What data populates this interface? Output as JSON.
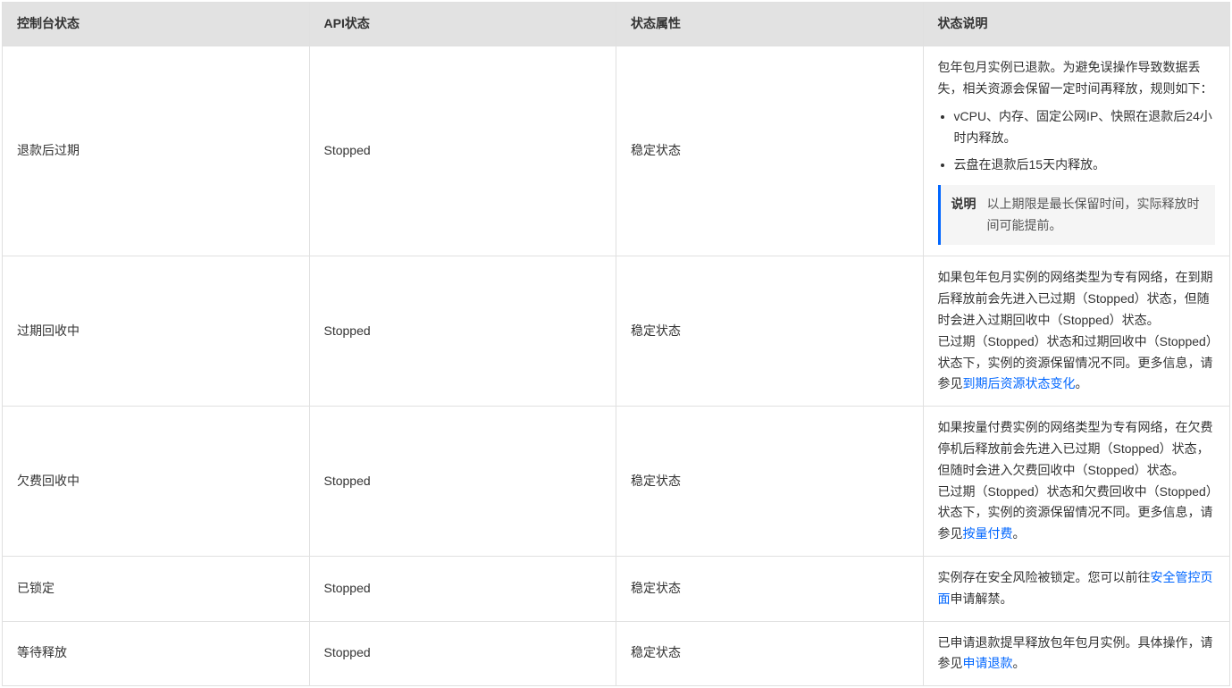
{
  "headers": {
    "consoleStatus": "控制台状态",
    "apiStatus": "API状态",
    "statusAttr": "状态属性",
    "statusDesc": "状态说明"
  },
  "rows": {
    "r0": {
      "consoleStatus": "退款后过期",
      "apiStatus": "Stopped",
      "statusAttr": "稳定状态",
      "desc": {
        "intro": "包年包月实例已退款。为避免误操作导致数据丢失，相关资源会保留一定时间再释放，规则如下：",
        "li1": "vCPU、内存、固定公网IP、快照在退款后24小时内释放。",
        "li2": "云盘在退款后15天内释放。",
        "noteLabel": "说明",
        "noteText": "以上期限是最长保留时间，实际释放时间可能提前。"
      }
    },
    "r1": {
      "consoleStatus": "过期回收中",
      "apiStatus": "Stopped",
      "statusAttr": "稳定状态",
      "desc": {
        "p1": "如果包年包月实例的网络类型为专有网络，在到期后释放前会先进入已过期（Stopped）状态，但随时会进入过期回收中（Stopped）状态。",
        "p2a": "已过期（Stopped）状态和过期回收中（Stopped）状态下，实例的资源保留情况不同。更多信息，请参见",
        "link": "到期后资源状态变化",
        "p2b": "。"
      }
    },
    "r2": {
      "consoleStatus": "欠费回收中",
      "apiStatus": "Stopped",
      "statusAttr": "稳定状态",
      "desc": {
        "p1": "如果按量付费实例的网络类型为专有网络，在欠费停机后释放前会先进入已过期（Stopped）状态，但随时会进入欠费回收中（Stopped）状态。",
        "p2a": "已过期（Stopped）状态和欠费回收中（Stopped）状态下，实例的资源保留情况不同。更多信息，请参见",
        "link": "按量付费",
        "p2b": "。"
      }
    },
    "r3": {
      "consoleStatus": "已锁定",
      "apiStatus": "Stopped",
      "statusAttr": "稳定状态",
      "desc": {
        "p1a": "实例存在安全风险被锁定。您可以前往",
        "link": "安全管控页面",
        "p1b": "申请解禁。"
      }
    },
    "r4": {
      "consoleStatus": "等待释放",
      "apiStatus": "Stopped",
      "statusAttr": "稳定状态",
      "desc": {
        "p1a": "已申请退款提早释放包年包月实例。具体操作，请参见",
        "link": "申请退款",
        "p1b": "。"
      }
    }
  }
}
